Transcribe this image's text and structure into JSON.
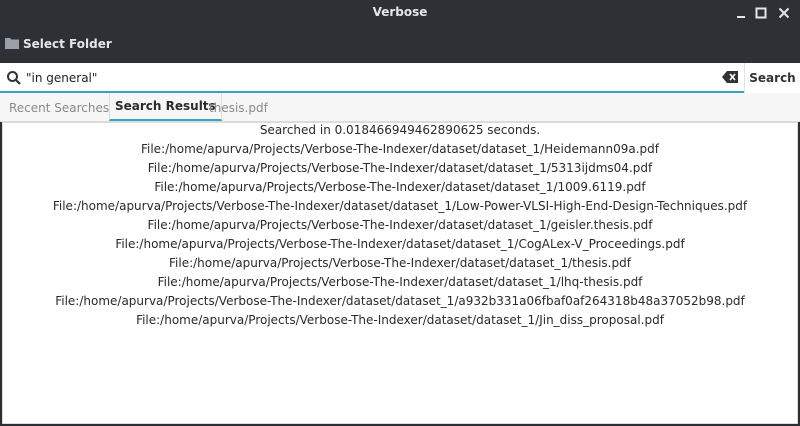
{
  "window": {
    "title": "Verbose"
  },
  "toolbar": {
    "select_folder_label": "Select Folder"
  },
  "search": {
    "query": "\"in general\"",
    "button_label": "Search"
  },
  "tabs": [
    {
      "label": "Recent Searches"
    },
    {
      "label": "Search Results"
    },
    {
      "label": "thesis.pdf"
    }
  ],
  "results": {
    "status": "Searched in 0.018466949462890625 seconds.",
    "files": [
      "File:/home/apurva/Projects/Verbose-The-Indexer/dataset/dataset_1/Heidemann09a.pdf",
      "File:/home/apurva/Projects/Verbose-The-Indexer/dataset/dataset_1/5313ijdms04.pdf",
      "File:/home/apurva/Projects/Verbose-The-Indexer/dataset/dataset_1/1009.6119.pdf",
      "File:/home/apurva/Projects/Verbose-The-Indexer/dataset/dataset_1/Low-Power-VLSI-High-End-Design-Techniques.pdf",
      "File:/home/apurva/Projects/Verbose-The-Indexer/dataset/dataset_1/geisler.thesis.pdf",
      "File:/home/apurva/Projects/Verbose-The-Indexer/dataset/dataset_1/CogALex-V_Proceedings.pdf",
      "File:/home/apurva/Projects/Verbose-The-Indexer/dataset/dataset_1/thesis.pdf",
      "File:/home/apurva/Projects/Verbose-The-Indexer/dataset/dataset_1/lhq-thesis.pdf",
      "File:/home/apurva/Projects/Verbose-The-Indexer/dataset/dataset_1/a932b331a06fbaf0af264318b48a37052b98.pdf",
      "File:/home/apurva/Projects/Verbose-The-Indexer/dataset/dataset_1/Jin_diss_proposal.pdf"
    ]
  },
  "colors": {
    "accent": "#33a6c5",
    "titlebar": "#2d3035"
  },
  "icons": [
    "folder-icon",
    "search-icon",
    "clear-icon",
    "minimize-icon",
    "maximize-icon",
    "close-icon"
  ]
}
